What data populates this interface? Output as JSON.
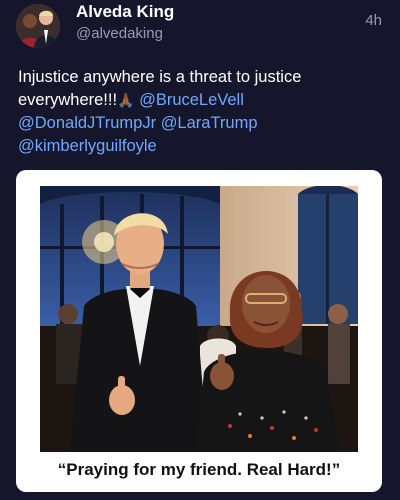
{
  "post": {
    "display_name": "Alveda King",
    "handle": "@alvedaking",
    "timestamp": "4h",
    "text_intro": "Injustice anywhere is a threat to justice everywhere!!!",
    "pray_emoji": "🙏🏾",
    "mentions": [
      "@BruceLeVell",
      "@DonaldJTrumpJr",
      "@LaraTrump",
      "@kimberlyguilfoyle"
    ],
    "avatar_icon": "profile-photo-two-people",
    "card": {
      "quote": "“Praying for my friend. Real Hard!”"
    }
  },
  "colors": {
    "background": "#15162b",
    "mention": "#6fa8ff",
    "secondary_text": "#9a9bb0",
    "card_background": "#ffffff"
  }
}
